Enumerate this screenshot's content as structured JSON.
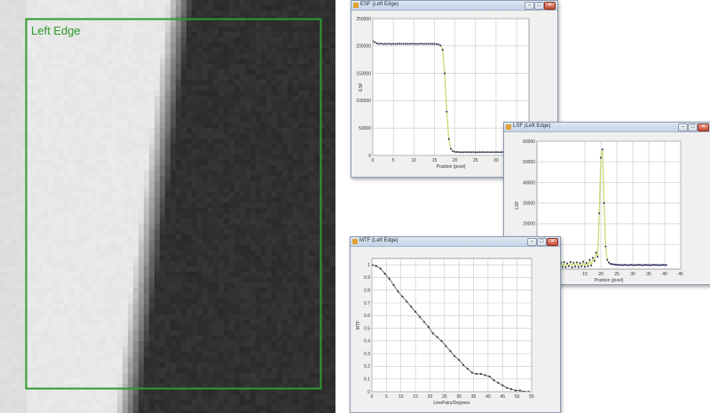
{
  "roi": {
    "label": "Left Edge",
    "color": "#2e9a2e"
  },
  "windows": {
    "esf": {
      "title": "ESF (Left Edge)",
      "controls": {
        "minimize": "–",
        "maximize": "□",
        "close": "✕"
      },
      "chart_data": {
        "type": "line",
        "title": "",
        "xlabel": "Position (pixel)",
        "ylabel": "ESF",
        "xlim": [
          0,
          38
        ],
        "ylim": [
          0,
          250000
        ],
        "xticks": [
          0,
          5,
          10,
          15,
          20,
          25,
          30,
          35
        ],
        "yticks": [
          0,
          50000,
          100000,
          150000,
          200000,
          250000
        ],
        "ytick_labels": [
          "0",
          "50000",
          "100000",
          "150000",
          "200000",
          "250000"
        ],
        "grid": true,
        "series": [
          {
            "x": [
              0,
              0.5,
              1,
              1.5,
              2,
              2.5,
              3,
              3.5,
              4,
              4.5,
              5,
              5.5,
              6,
              6.5,
              7,
              7.5,
              8,
              8.5,
              9,
              9.5,
              10,
              10.5,
              11,
              11.5,
              12,
              12.5,
              13,
              13.5,
              14,
              14.5,
              15,
              15.5,
              16,
              16.5,
              17,
              17.5,
              18,
              18.5,
              19,
              19.5,
              20,
              20.5,
              21,
              21.5,
              22,
              22.5,
              23,
              23.5,
              24,
              24.5,
              25,
              25.5,
              26,
              26.5,
              27,
              27.5,
              28,
              28.5,
              29,
              29.5,
              30,
              30.5,
              31,
              31.5,
              32,
              32.5,
              33,
              33.5,
              34,
              34.5,
              35,
              35.5,
              36,
              36.5,
              37,
              37.5
            ],
            "y": [
              209000,
              207000,
              205000,
              204000,
              204500,
              203500,
              204000,
              203800,
              204200,
              203600,
              204000,
              203800,
              203700,
              204100,
              203900,
              203800,
              204000,
              203700,
              203900,
              204100,
              203800,
              204000,
              203600,
              204100,
              203900,
              203800,
              204000,
              203900,
              203700,
              204000,
              203800,
              203600,
              203000,
              201000,
              193000,
              150000,
              80000,
              30000,
              12000,
              8000,
              6500,
              6200,
              6000,
              5800,
              5900,
              6000,
              5800,
              6100,
              5900,
              6000,
              5800,
              5900,
              6100,
              5800,
              6000,
              5900,
              6000,
              5800,
              6100,
              5900,
              6000,
              5900,
              5800,
              6000,
              5900,
              6100,
              5800,
              6000,
              5900,
              6000,
              5800,
              6000,
              5900,
              6100,
              5900,
              6000
            ],
            "color": "#2b2f60",
            "fit_color": "#c9d97a"
          }
        ]
      }
    },
    "lsf": {
      "title": "LSF (Left Edge)",
      "controls": {
        "minimize": "–",
        "maximize": "□",
        "close": "✕"
      },
      "chart_data": {
        "type": "line",
        "title": "",
        "xlabel": "Position (pixel)",
        "ylabel": "LSF",
        "xlim": [
          0,
          45
        ],
        "ylim": [
          -2000,
          60000
        ],
        "xticks": [
          15,
          20,
          25,
          30,
          35,
          40,
          45
        ],
        "yticks": [
          10000,
          20000,
          30000,
          40000,
          50000,
          60000
        ],
        "ytick_labels": [
          "10000",
          "20000",
          "30000",
          "40000",
          "50000",
          "60000"
        ],
        "grid": true,
        "series": [
          {
            "x": [
              0,
              0.5,
              1,
              1.5,
              2,
              2.5,
              3,
              3.5,
              4,
              4.5,
              5,
              5.5,
              6,
              6.5,
              7,
              7.5,
              8,
              8.5,
              9,
              9.5,
              10,
              10.5,
              11,
              11.5,
              12,
              12.5,
              13,
              13.5,
              14,
              14.5,
              15,
              15.5,
              16,
              16.5,
              17,
              17.5,
              18,
              18.5,
              19,
              19.5,
              20,
              20.5,
              21,
              21.5,
              22,
              22.5,
              23,
              23.5,
              24,
              24.5,
              25,
              25.5,
              26,
              26.5,
              27,
              27.5,
              28,
              28.5,
              29,
              29.5,
              30,
              30.5,
              31,
              31.5,
              32,
              32.5,
              33,
              33.5,
              34,
              34.5,
              35,
              35.5,
              36,
              36.5,
              37,
              37.5,
              38,
              38.5,
              39,
              39.5,
              40,
              40.5
            ],
            "y": [
              -500,
              1200,
              -1000,
              1400,
              -800,
              1600,
              -1200,
              1000,
              -600,
              1500,
              -1300,
              900,
              -700,
              1700,
              -1000,
              1200,
              -900,
              1400,
              -1100,
              800,
              -600,
              1500,
              -1200,
              1100,
              -800,
              1300,
              -1000,
              900,
              -700,
              1600,
              -900,
              1000,
              -600,
              2500,
              -300,
              3500,
              2000,
              6000,
              4000,
              25000,
              52000,
              56000,
              30000,
              9000,
              2500,
              1200,
              600,
              400,
              300,
              200,
              100,
              0,
              100,
              -100,
              0,
              100,
              0,
              -100,
              0,
              100,
              0,
              -100,
              0,
              0,
              100,
              0,
              -100,
              0,
              100,
              0,
              0,
              -100,
              0,
              100,
              0,
              0,
              0,
              -100,
              0,
              100,
              0,
              0
            ],
            "color": "#2b2f60",
            "fit_color": "#c9d97a"
          }
        ]
      }
    },
    "mtf": {
      "title": "MTF (Left Edge)",
      "controls": {
        "minimize": "–",
        "maximize": "□",
        "close": "✕"
      },
      "chart_data": {
        "type": "line",
        "title": "",
        "xlabel": "LinePairs/Degrees",
        "ylabel": "MTF",
        "xlim": [
          0,
          55
        ],
        "ylim": [
          0,
          1.05
        ],
        "xticks": [
          0,
          5,
          10,
          15,
          20,
          25,
          30,
          35,
          40,
          45,
          50,
          55
        ],
        "yticks": [
          0,
          0.1,
          0.2,
          0.3,
          0.4,
          0.5,
          0.6,
          0.7,
          0.8,
          0.9,
          1
        ],
        "ytick_labels": [
          "0",
          "0.1",
          "0.2",
          "0.3",
          "0.4",
          "0.5",
          "0.6",
          "0.7",
          "0.8",
          "0.9",
          "1"
        ],
        "grid": true,
        "series": [
          {
            "x": [
              0,
              1.5,
              3,
              4.5,
              6,
              7.5,
              9,
              10.5,
              12,
              13.5,
              15,
              16.5,
              18,
              19.5,
              21,
              22.5,
              24,
              25.5,
              27,
              28.5,
              30,
              31.5,
              33,
              34.5,
              36,
              37.5,
              39,
              40.5,
              42,
              43.5,
              45,
              46.5,
              48,
              49.5,
              51,
              52.5,
              54
            ],
            "y": [
              1.0,
              0.99,
              0.97,
              0.93,
              0.89,
              0.84,
              0.79,
              0.75,
              0.71,
              0.67,
              0.63,
              0.59,
              0.55,
              0.51,
              0.46,
              0.43,
              0.4,
              0.36,
              0.32,
              0.28,
              0.25,
              0.21,
              0.18,
              0.15,
              0.14,
              0.14,
              0.13,
              0.12,
              0.09,
              0.07,
              0.05,
              0.03,
              0.02,
              0.01,
              0.01,
              0.0,
              0.0
            ],
            "color": "#3a3d4a"
          }
        ]
      }
    }
  }
}
